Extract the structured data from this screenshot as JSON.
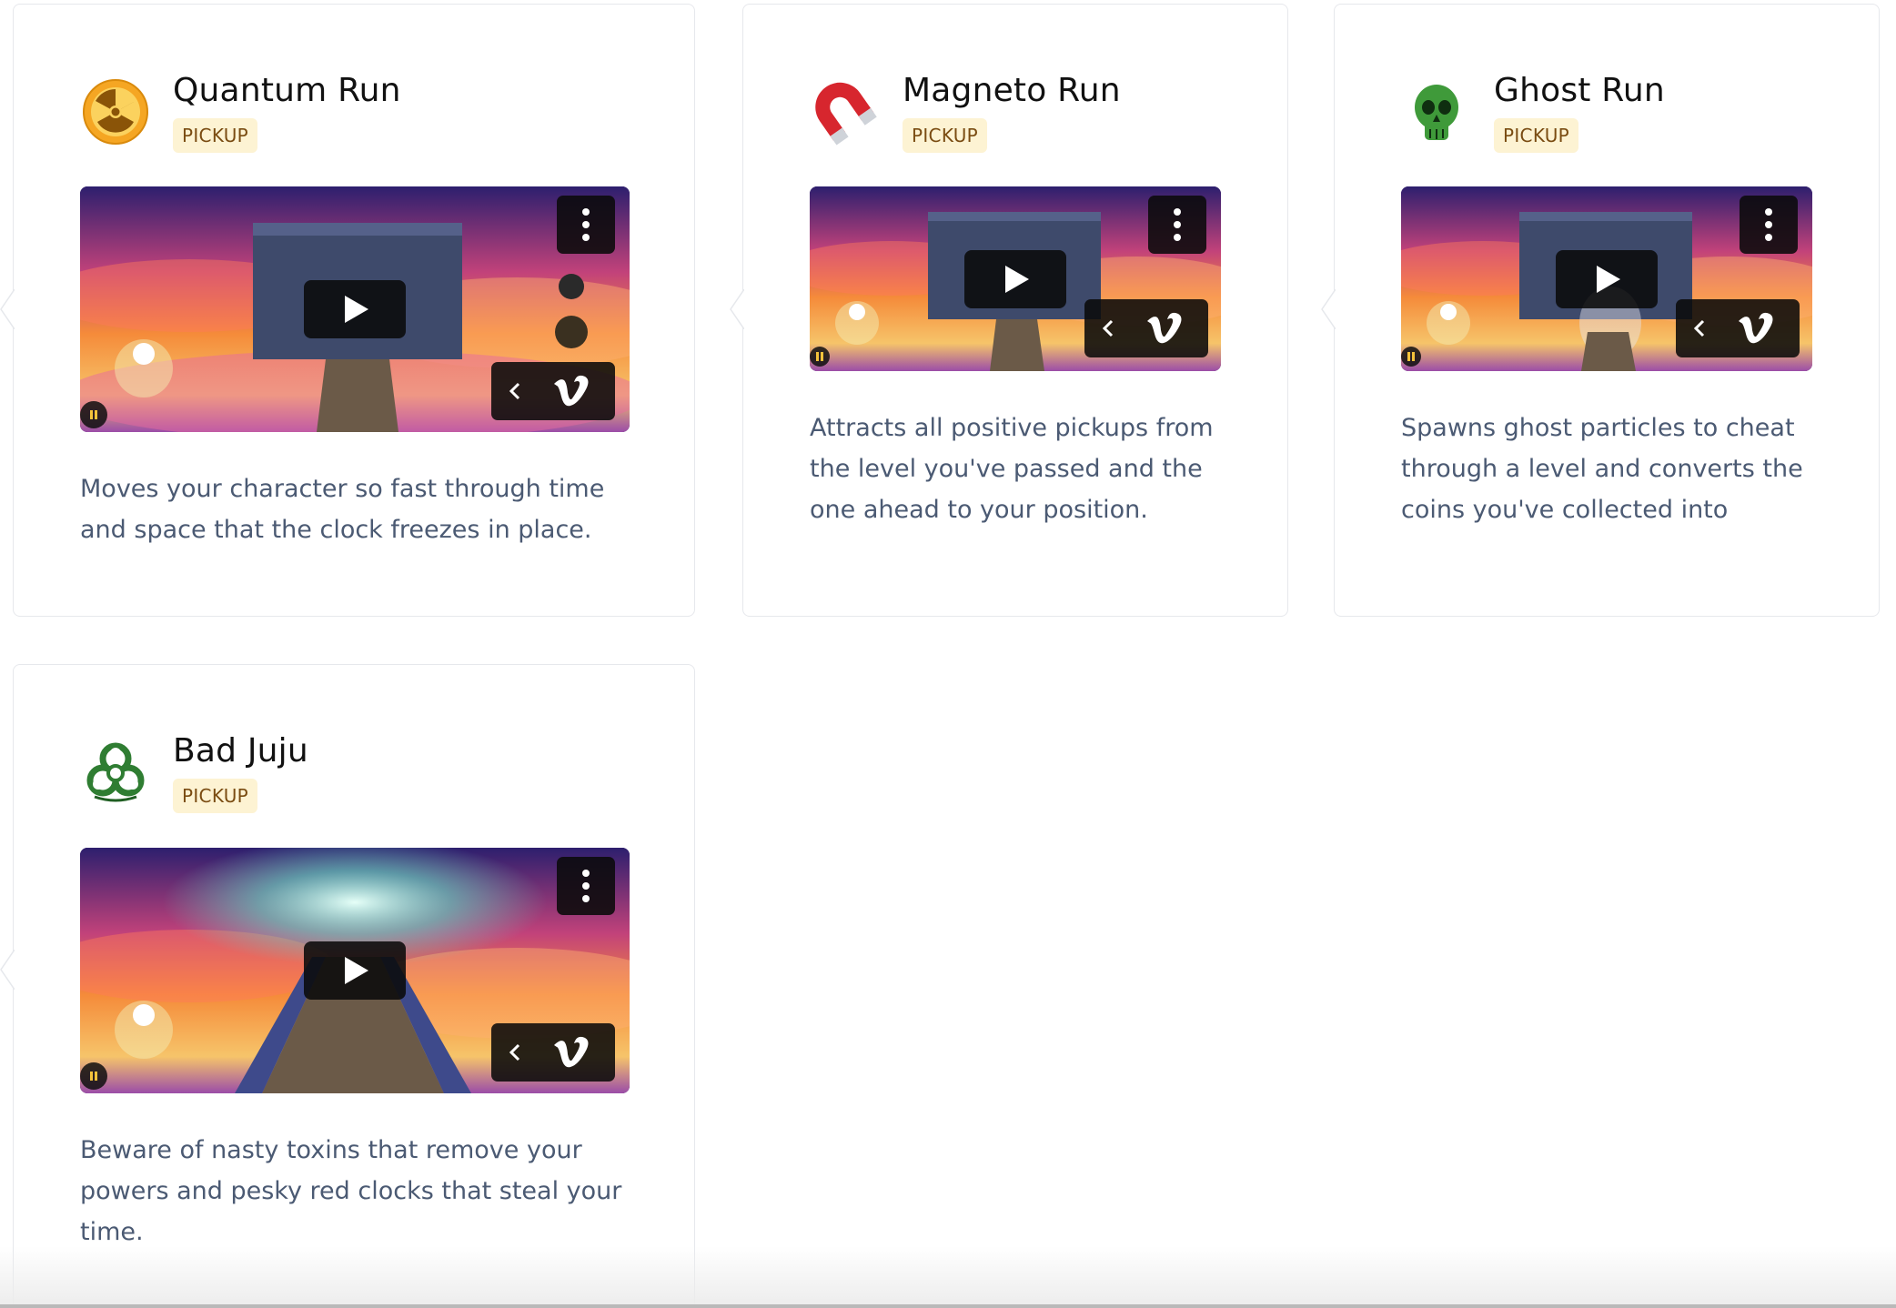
{
  "cards": [
    {
      "title": "Quantum Run",
      "badge": "PICKUP",
      "icon": "radioactive-icon",
      "description": "Moves your character so fast through time and space that the clock freezes in place."
    },
    {
      "title": "Magneto Run",
      "badge": "PICKUP",
      "icon": "magnet-icon",
      "description": "Attracts all positive pickups from the level you've passed and the one ahead to your position."
    },
    {
      "title": "Ghost Run",
      "badge": "PICKUP",
      "icon": "skull-icon",
      "description": "Spawns ghost particles to cheat through a level and converts the coins you've collected into"
    },
    {
      "title": "Bad Juju",
      "badge": "PICKUP",
      "icon": "biohazard-icon",
      "description": "Beware of nasty toxins that remove your powers and pesky red clocks that steal your time."
    }
  ],
  "colors": {
    "badge_bg": "#fdf3d3",
    "badge_text": "#7a4c12",
    "description_text": "#4b5a73",
    "title_text": "#111111",
    "card_border": "#e6e8ec"
  }
}
